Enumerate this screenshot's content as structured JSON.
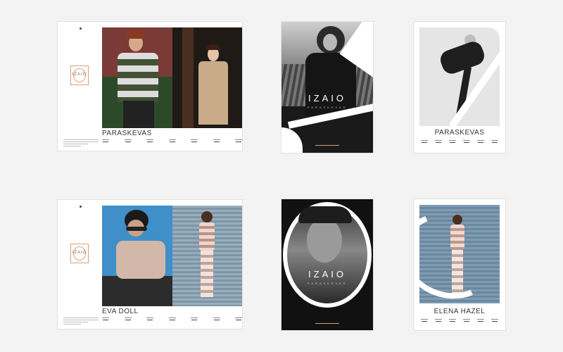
{
  "brand": {
    "logo": "IZAIO",
    "tagline": "PARASKEVAS"
  },
  "cards": {
    "top_landscape": {
      "name": "PARASKEVAS"
    },
    "top_cover": {
      "logo": "IZAIO",
      "sub": "PARASKEVAS"
    },
    "top_portrait": {
      "name": "PARASKEVAS"
    },
    "bottom_landscape": {
      "name": "EVA DOLL"
    },
    "bottom_cover": {
      "logo": "IZAIO",
      "sub": "PARASKEVAS"
    },
    "bottom_portrait": {
      "name": "ELENA HAZEL"
    }
  },
  "colors": {
    "accent": "#d8a07a",
    "background": "#f3f3f3"
  }
}
